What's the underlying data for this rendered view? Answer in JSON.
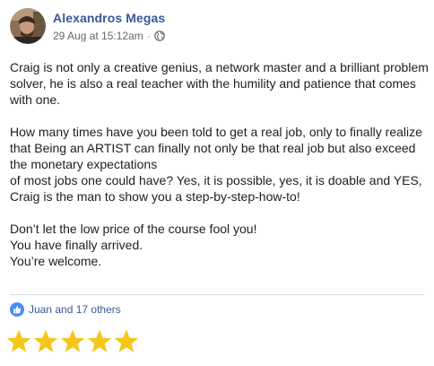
{
  "post": {
    "author": "Alexandros Megas",
    "timestamp": "29 Aug at 15:12am",
    "separator": "·",
    "privacy_icon": "globe-icon",
    "paragraphs": [
      "Craig is not only a creative genius, a network master and a brilliant problem solver, he is also a real teacher with the humility and patience that comes with one.",
      "How many times have you been told to get a real job, only to finally realize that Being an ARTIST can finally not only be that real job but also exceed the monetary expectations\nof most jobs one could have? Yes, it is possible, yes, it is doable and YES, Craig is the man to show you a step-by-step-how-to!",
      "Don’t let the low price of the course fool you!\nYou have finally arrived.\nYou’re welcome."
    ]
  },
  "reactions": {
    "icon": "like-icon",
    "label": "Juan and 17 others"
  },
  "rating": {
    "value": 5,
    "max": 5,
    "star_color": "#f5c518"
  },
  "colors": {
    "author": "#385898",
    "like": "#4a8cf7",
    "text": "#1c1e21",
    "meta": "#616770"
  }
}
